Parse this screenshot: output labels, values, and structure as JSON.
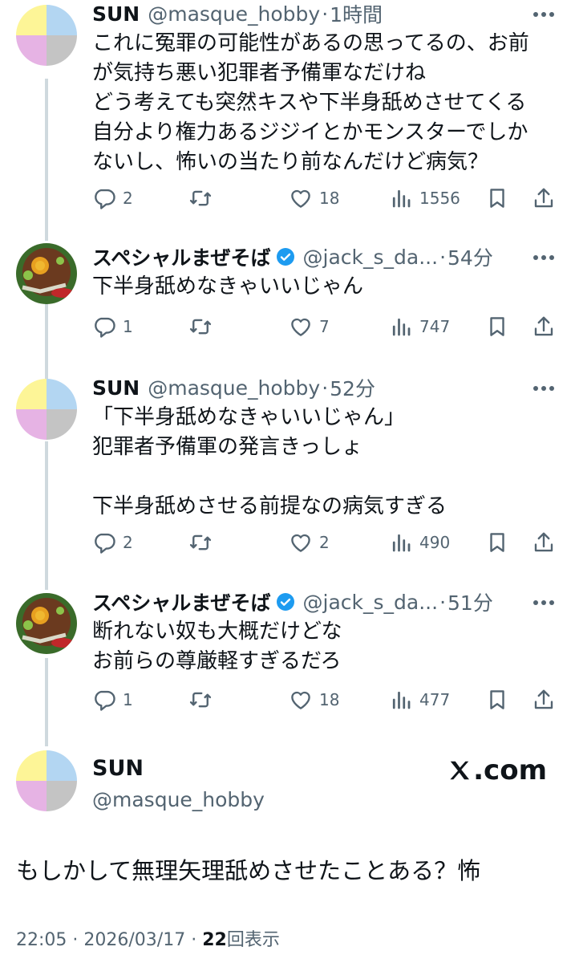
{
  "tweets": [
    {
      "name": "SUN",
      "handle": "@masque_hobby",
      "sep": "·",
      "time": "1時間",
      "verified": false,
      "avatar": "quad-color-avatar",
      "text": "これに冤罪の可能性があるの思ってるの、お前\nが気持ち悪い犯罪者予備軍なだけね\nどう考えても突然キスや下半身舐めさせてくる\n自分より権力あるジジイとかモンスターでしか\nないし、怖いの当たり前なんだけど病気？",
      "replies": "2",
      "retweets": "",
      "likes": "18",
      "views": "1556"
    },
    {
      "name": "スペシャルまぜそば",
      "handle": "@jack_s_da...",
      "sep": "·",
      "time": "54分",
      "verified": true,
      "avatar": "mazesoba-photo-avatar",
      "text": "下半身舐めなきゃいいじゃん",
      "replies": "1",
      "retweets": "",
      "likes": "7",
      "views": "747"
    },
    {
      "name": "SUN",
      "handle": "@masque_hobby",
      "sep": "·",
      "time": "52分",
      "verified": false,
      "avatar": "quad-color-avatar",
      "text": "「下半身舐めなきゃいいじゃん」\n犯罪者予備軍の発言きっしょ\n\n下半身舐めさせる前提なの病気すぎる",
      "replies": "2",
      "retweets": "",
      "likes": "2",
      "views": "490"
    },
    {
      "name": "スペシャルまぜそば",
      "handle": "@jack_s_da...",
      "sep": "·",
      "time": "51分",
      "verified": true,
      "avatar": "mazesoba-photo-avatar",
      "text": "断れない奴も大概だけどな\nお前らの尊厳軽すぎるだろ",
      "replies": "1",
      "retweets": "",
      "likes": "18",
      "views": "477"
    }
  ],
  "main": {
    "name": "SUN",
    "handle": "@masque_hobby",
    "text": "もしかして無理矢理舐めさせたことある？怖",
    "time": "22:05",
    "sep": "·",
    "date": "2026/03/17",
    "views_count": "22",
    "views_label": "回表示"
  },
  "brand": {
    "logo_text": ".com",
    "icon": "x-logo-icon"
  },
  "icons": {
    "reply": "reply-icon",
    "retweet": "retweet-icon",
    "like": "heart-icon",
    "views": "views-icon",
    "bookmark": "bookmark-icon",
    "share": "share-icon",
    "more": "more-icon",
    "verified": "verified-badge-icon"
  },
  "colors": {
    "avatar_yellow": "#fdf597",
    "avatar_blue": "#b3d6f2",
    "avatar_pink": "#e6b3e4",
    "avatar_gray": "#c4c4c4",
    "verified_blue": "#1d9bf0",
    "secondary_text": "#536471",
    "thread_line": "#cfd9de"
  }
}
